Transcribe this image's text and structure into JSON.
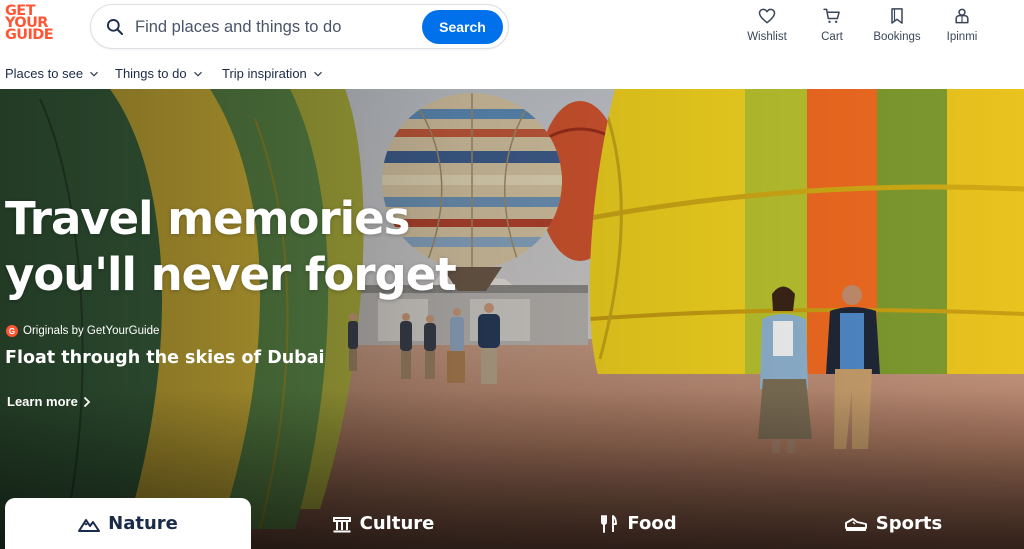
{
  "brand": {
    "logo_line1": "GET",
    "logo_line2": "YOUR",
    "logo_line3": "GUIDE",
    "color": "#ff5533"
  },
  "search": {
    "placeholder": "Find places and things to do",
    "button_label": "Search",
    "button_color": "#0071eb"
  },
  "header_nav": [
    {
      "label": "Wishlist",
      "icon": "heart-icon"
    },
    {
      "label": "Cart",
      "icon": "cart-icon"
    },
    {
      "label": "Bookings",
      "icon": "bookmark-icon"
    },
    {
      "label": "Ipinmi",
      "icon": "user-icon"
    }
  ],
  "subnav": [
    {
      "label": "Places to see"
    },
    {
      "label": "Things to do"
    },
    {
      "label": "Trip inspiration"
    }
  ],
  "hero": {
    "title_line1": "Travel memories",
    "title_line2": "you'll never forget",
    "badge_letter": "G",
    "originals_label": "Originals by GetYourGuide",
    "subtitle": "Float through the skies of Dubai",
    "cta_label": "Learn more"
  },
  "categories": [
    {
      "label": "Nature",
      "icon": "mountain-icon",
      "active": true
    },
    {
      "label": "Culture",
      "icon": "museum-icon",
      "active": false
    },
    {
      "label": "Food",
      "icon": "fork-knife-icon",
      "active": false
    },
    {
      "label": "Sports",
      "icon": "sneaker-icon",
      "active": false
    }
  ]
}
